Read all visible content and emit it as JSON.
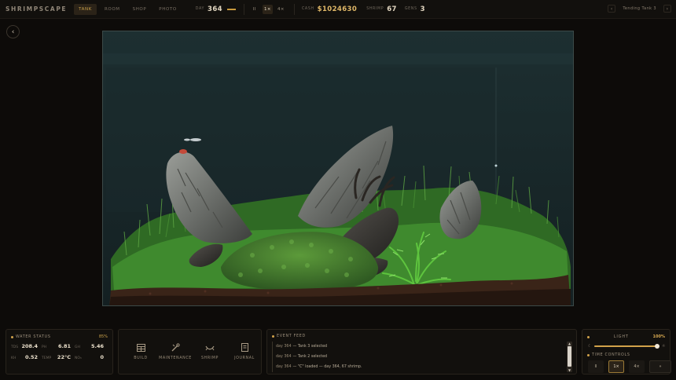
{
  "topbar": {
    "brand": "SHRIMPSCAPE",
    "tabs": [
      {
        "label": "TANK",
        "active": true
      },
      {
        "label": "ROOM",
        "active": false
      },
      {
        "label": "SHOP",
        "active": false
      },
      {
        "label": "PHOTO",
        "active": false
      }
    ],
    "day_label": "DAY",
    "day_value": "364",
    "speed": {
      "pause": "II",
      "normal": "1×",
      "fast": "4×"
    },
    "cash_label": "CASH",
    "cash_value": "$1024630",
    "shrimp_label": "SHRIMP",
    "shrimp_value": "67",
    "gens_label": "GENS",
    "gens_value": "3",
    "tank_name": "Tending Tank 3",
    "prev_icon": "chevron-left-icon",
    "next_icon": "chevron-right-icon"
  },
  "back_icon": "chevron-left-icon",
  "water": {
    "title": "WATER STATUS",
    "percent": "85%",
    "params": [
      {
        "key": "TDS",
        "value": "208.4"
      },
      {
        "key": "PH",
        "value": "6.81"
      },
      {
        "key": "GH",
        "value": "5.46"
      },
      {
        "key": "KH",
        "value": "0.52"
      },
      {
        "key": "TEMP",
        "value": "22°C"
      },
      {
        "key": "NO₃",
        "value": "0"
      }
    ]
  },
  "actions": [
    {
      "label": "BUILD",
      "icon": "grid-icon"
    },
    {
      "label": "MAINTENANCE",
      "icon": "tools-icon"
    },
    {
      "label": "SHRIMP",
      "icon": "shrimp-icon"
    },
    {
      "label": "JOURNAL",
      "icon": "book-icon"
    }
  ],
  "feed": {
    "title": "EVENT FEED",
    "items": [
      {
        "day": "day 364",
        "text": "— Tank 3 selected"
      },
      {
        "day": "day 364",
        "text": "— Tank 2 selected"
      },
      {
        "day": "day 364",
        "text": "— \"C\" loaded — day 364, 67 shrimp."
      }
    ]
  },
  "light": {
    "label": "LIGHT",
    "value_text": "100%",
    "level": 1.0
  },
  "time_controls": {
    "title": "TIME CONTROLS",
    "pause": "II",
    "normal": "1×",
    "fast": "4×",
    "skip": "»"
  },
  "colors": {
    "accent": "#d1a24a",
    "cash": "#e0b868",
    "background": "#0d0b09",
    "panel": "#12100d"
  }
}
